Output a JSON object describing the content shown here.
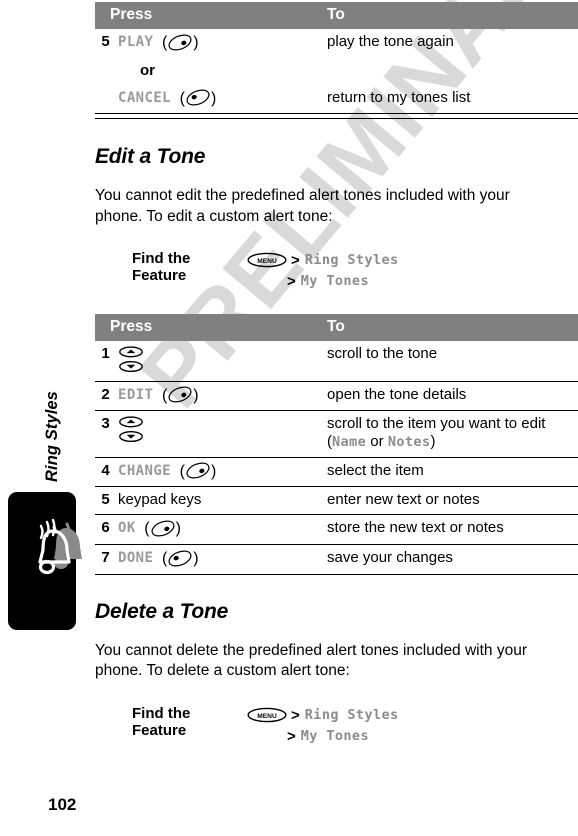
{
  "page": {
    "number": "102",
    "watermark": "PRELIMINARY",
    "side_label": "Ring Styles",
    "bell_icon": "bell-icon"
  },
  "table_top": {
    "headers": {
      "press": "Press",
      "to": "To"
    },
    "rows": [
      {
        "num": "5",
        "press_label": "PLAY",
        "press_key": "left-softkey-icon",
        "to": "play the tone again"
      },
      {
        "num": "",
        "press_label": "or",
        "press_key": "",
        "to": ""
      },
      {
        "num": "",
        "press_label": "CANCEL",
        "press_key": "right-softkey-icon",
        "to": "return to my tones list"
      }
    ]
  },
  "section_edit": {
    "heading": "Edit a Tone",
    "paragraph": "You cannot edit the predefined alert tones included with your phone. To edit a custom alert tone:",
    "find_the_feature": {
      "label": "Find the Feature",
      "menu_icon": "MENU",
      "separator": ">",
      "path": [
        "Ring Styles",
        "My Tones"
      ]
    }
  },
  "table_edit": {
    "headers": {
      "press": "Press",
      "to": "To"
    },
    "rows": [
      {
        "num": "1",
        "press_label": "",
        "press_key": "scroll-keys-icon",
        "to": "scroll to the tone"
      },
      {
        "num": "2",
        "press_label": "EDIT",
        "press_key": "left-softkey-icon",
        "to": "open the tone details"
      },
      {
        "num": "3",
        "press_label": "",
        "press_key": "scroll-keys-icon",
        "to_pre": "scroll to the item you want to edit (",
        "to_a": "Name",
        "to_mid": " or ",
        "to_b": "Notes",
        "to_post": ")"
      },
      {
        "num": "4",
        "press_label": "CHANGE",
        "press_key": "left-softkey-icon",
        "to": "select the item"
      },
      {
        "num": "5",
        "press_plain": "keypad keys",
        "to": "enter new text or notes"
      },
      {
        "num": "6",
        "press_label": "OK",
        "press_key": "left-softkey-icon",
        "to": "store the new text or notes"
      },
      {
        "num": "7",
        "press_label": "DONE",
        "press_key": "right-softkey-icon",
        "to": "save your changes"
      }
    ]
  },
  "section_delete": {
    "heading": "Delete a Tone",
    "paragraph": "You cannot delete the predefined alert tones included with your phone. To delete a custom alert tone:",
    "find_the_feature": {
      "label": "Find the Feature",
      "menu_icon": "MENU",
      "separator": ">",
      "path": [
        "Ring Styles",
        "My Tones"
      ]
    }
  },
  "colors": {
    "header_gray": "#808080",
    "display_text": "#9a9a9a",
    "watermark": "#d9d9d9"
  }
}
